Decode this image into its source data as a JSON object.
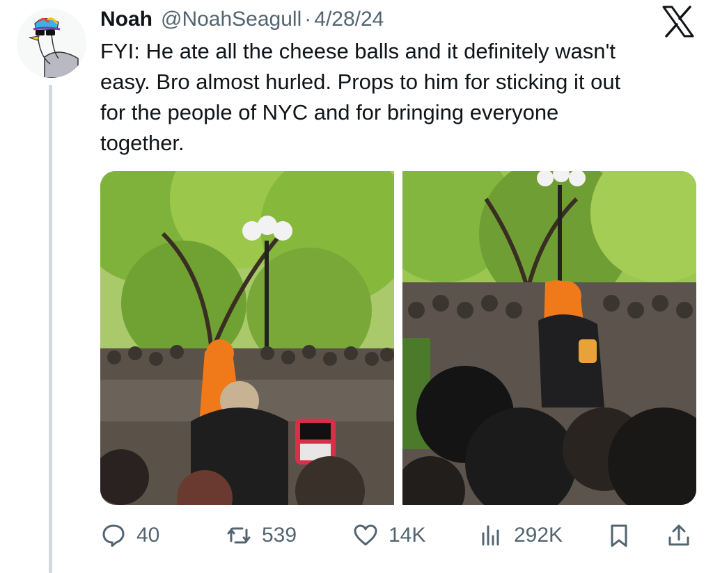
{
  "tweet": {
    "author_name": "Noah",
    "handle": "@NoahSeagull",
    "separator": "·",
    "date": "4/28/24",
    "text_lines": [
      "FYI: He ate all the cheese balls and it definitely wasn't",
      "easy. Bro almost hurled. Props to him for sticking it out",
      "for the people of NYC and for bringing everyone",
      "together."
    ]
  },
  "media": [
    {
      "kind": "photo",
      "subject": "crowd in park around person in orange mask"
    },
    {
      "kind": "photo",
      "subject": "person in orange mask holding cheese balls jar"
    }
  ],
  "actions": {
    "reply": {
      "icon": "reply-icon",
      "count": "40"
    },
    "retweet": {
      "icon": "retweet-icon",
      "count": "539"
    },
    "like": {
      "icon": "heart-icon",
      "count": "14K"
    },
    "views": {
      "icon": "views-icon",
      "count": "292K"
    },
    "bookmark": {
      "icon": "bookmark-icon"
    },
    "share": {
      "icon": "share-icon"
    }
  },
  "colors": {
    "text": "#0f1419",
    "secondary": "#536471",
    "thread_line": "#cfd9de",
    "mask_orange": "#f07a1a",
    "foliage": "#8dbd3a"
  }
}
